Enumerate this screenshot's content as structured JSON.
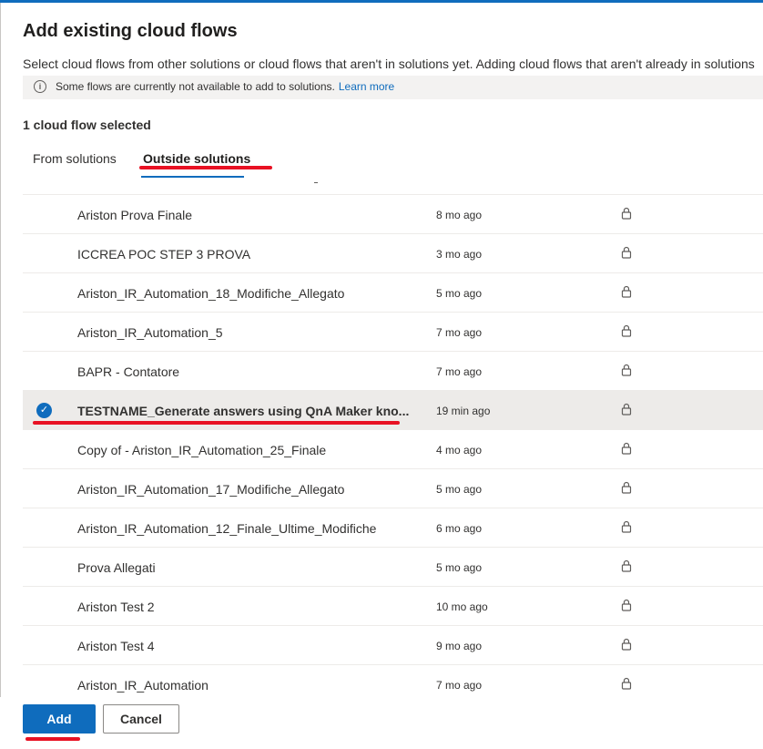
{
  "dialog": {
    "title": "Add existing cloud flows",
    "description": "Select cloud flows from other solutions or cloud flows that aren't in solutions yet. Adding cloud flows that aren't already in solutions",
    "info_text": "Some flows are currently not available to add to solutions.",
    "info_link": "Learn more",
    "selected_count": "1 cloud flow selected"
  },
  "tabs": [
    {
      "label": "From solutions",
      "active": false
    },
    {
      "label": "Outside solutions",
      "active": true
    }
  ],
  "flows": [
    {
      "name": "Ariston Prova Finale",
      "modified": "8 mo ago",
      "selected": false
    },
    {
      "name": "ICCREA POC STEP 3 PROVA",
      "modified": "3 mo ago",
      "selected": false
    },
    {
      "name": "Ariston_IR_Automation_18_Modifiche_Allegato",
      "modified": "5 mo ago",
      "selected": false
    },
    {
      "name": "Ariston_IR_Automation_5",
      "modified": "7 mo ago",
      "selected": false
    },
    {
      "name": "BAPR - Contatore",
      "modified": "7 mo ago",
      "selected": false
    },
    {
      "name": "TESTNAME_Generate answers using QnA Maker kno...",
      "modified": "19 min ago",
      "selected": true
    },
    {
      "name": "Copy of - Ariston_IR_Automation_25_Finale",
      "modified": "4 mo ago",
      "selected": false
    },
    {
      "name": "Ariston_IR_Automation_17_Modifiche_Allegato",
      "modified": "5 mo ago",
      "selected": false
    },
    {
      "name": "Ariston_IR_Automation_12_Finale_Ultime_Modifiche",
      "modified": "6 mo ago",
      "selected": false
    },
    {
      "name": "Prova Allegati",
      "modified": "5 mo ago",
      "selected": false
    },
    {
      "name": "Ariston Test 2",
      "modified": "10 mo ago",
      "selected": false
    },
    {
      "name": "Ariston Test 4",
      "modified": "9 mo ago",
      "selected": false
    },
    {
      "name": "Ariston_IR_Automation",
      "modified": "7 mo ago",
      "selected": false
    }
  ],
  "footer": {
    "add_label": "Add",
    "cancel_label": "Cancel"
  },
  "colors": {
    "accent": "#0f6cbd",
    "annotation": "#e81123",
    "selected_row": "#edebe9"
  },
  "icons": {
    "info": "info-icon",
    "lock": "lock-icon",
    "check": "checkmark-circle-icon"
  }
}
